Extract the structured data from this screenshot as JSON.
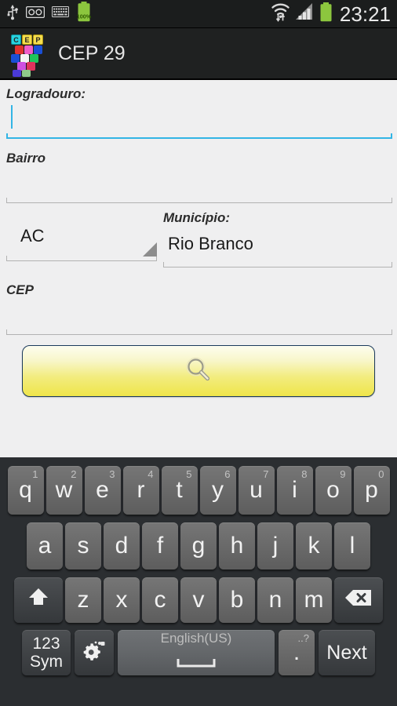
{
  "statusbar": {
    "left_icons": [
      "usb-icon",
      "voicemail-icon",
      "keyboard-icon",
      "battery-percent-icon"
    ],
    "battery_percent": "100%",
    "right_icons": [
      "wifi-icon",
      "signal-icon",
      "battery-icon"
    ],
    "clock": "23:21"
  },
  "actionbar": {
    "app_icon": "cep-app-icon",
    "icon_letters": [
      "C",
      "E",
      "P"
    ],
    "title": "CEP 29"
  },
  "form": {
    "logradouro": {
      "label": "Logradouro:",
      "value": "",
      "focused": true
    },
    "bairro": {
      "label": "Bairro",
      "value": "",
      "focused": false
    },
    "uf": {
      "label": "",
      "value": "AC",
      "focused": false
    },
    "municipio": {
      "label": "Município:",
      "value": "Rio Branco",
      "focused": false
    },
    "cep": {
      "label": "CEP",
      "value": "",
      "focused": false
    },
    "search_button": {
      "icon": "magnifier-icon",
      "label": ""
    }
  },
  "keyboard": {
    "row1": [
      {
        "key": "q",
        "sup": "1"
      },
      {
        "key": "w",
        "sup": "2"
      },
      {
        "key": "e",
        "sup": "3"
      },
      {
        "key": "r",
        "sup": "4"
      },
      {
        "key": "t",
        "sup": "5"
      },
      {
        "key": "y",
        "sup": "6"
      },
      {
        "key": "u",
        "sup": "7"
      },
      {
        "key": "i",
        "sup": "8"
      },
      {
        "key": "o",
        "sup": "9"
      },
      {
        "key": "p",
        "sup": "0"
      }
    ],
    "row2": [
      {
        "key": "a"
      },
      {
        "key": "s"
      },
      {
        "key": "d"
      },
      {
        "key": "f"
      },
      {
        "key": "g"
      },
      {
        "key": "h"
      },
      {
        "key": "j"
      },
      {
        "key": "k"
      },
      {
        "key": "l"
      }
    ],
    "row3": [
      {
        "key": "z"
      },
      {
        "key": "x"
      },
      {
        "key": "c"
      },
      {
        "key": "v"
      },
      {
        "key": "b"
      },
      {
        "key": "n"
      },
      {
        "key": "m"
      }
    ],
    "shift": "shift-icon",
    "backspace": "backspace-icon",
    "sym_line1": "123",
    "sym_line2": "Sym",
    "settings": "gear-icon",
    "space_label": "English(US)",
    "period": ".",
    "period_sup": "..?",
    "next": "Next"
  },
  "colors": {
    "accent": "#33b5e5",
    "page_bg": "#efeff0",
    "statusbar_bg": "#1b1d1d",
    "actionbar_bg": "#1f2121",
    "keyboard_bg": "#2b2e31",
    "button_yellow": "#efe54a",
    "battery_green": "#8cc63e"
  }
}
